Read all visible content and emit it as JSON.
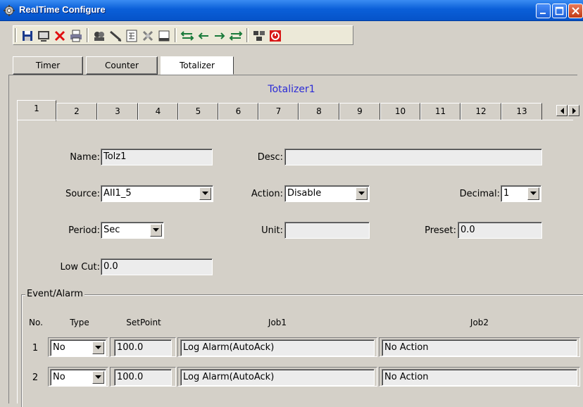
{
  "window": {
    "title": "RealTime Configure",
    "icon": "gear-app-icon",
    "controls": [
      "minimize-icon",
      "maximize-icon",
      "close-icon"
    ]
  },
  "toolbar": {
    "buttons": [
      {
        "name": "save",
        "icon": "floppy-icon"
      },
      {
        "name": "device",
        "icon": "monitor-icon"
      },
      {
        "name": "delete",
        "icon": "red-x-icon"
      },
      {
        "name": "print",
        "icon": "printer-icon"
      },
      {
        "name": "tags",
        "icon": "tag-group-icon"
      },
      {
        "name": "draw",
        "icon": "pencil-icon"
      },
      {
        "name": "calc",
        "icon": "calculator-icon"
      },
      {
        "name": "tools",
        "icon": "tools-icon"
      },
      {
        "name": "window",
        "icon": "window-icon"
      },
      {
        "name": "move-up-down",
        "icon": "arrows-updown-icon"
      },
      {
        "name": "move-left",
        "icon": "arrow-left-icon"
      },
      {
        "name": "move-right",
        "icon": "arrow-right-icon"
      },
      {
        "name": "move-both",
        "icon": "arrows-leftright-icon"
      },
      {
        "name": "network",
        "icon": "network-icon"
      },
      {
        "name": "stop",
        "icon": "stop-icon"
      }
    ]
  },
  "top_tabs": {
    "items": [
      "Timer",
      "Counter",
      "Totalizer"
    ],
    "active": "Totalizer"
  },
  "heading": "Totalizer1",
  "number_tabs": {
    "items": [
      "1",
      "2",
      "3",
      "4",
      "5",
      "6",
      "7",
      "8",
      "9",
      "10",
      "11",
      "12",
      "13"
    ],
    "active": "1"
  },
  "form": {
    "name_label": "Name:",
    "name_value": "Tolz1",
    "desc_label": "Desc:",
    "desc_value": "",
    "source_label": "Source:",
    "source_value": "AII1_5",
    "action_label": "Action:",
    "action_value": "Disable",
    "decimal_label": "Decimal:",
    "decimal_value": "1",
    "period_label": "Period:",
    "period_value": "Sec",
    "unit_label": "Unit:",
    "unit_value": "",
    "preset_label": "Preset:",
    "preset_value": "0.0",
    "lowcut_label": "Low Cut:",
    "lowcut_value": "0.0"
  },
  "event_alarm": {
    "title": "Event/Alarm",
    "columns": [
      "No.",
      "Type",
      "SetPoint",
      "Job1",
      "Job2"
    ],
    "rows": [
      {
        "no": "1",
        "type": "No",
        "setpoint": "100.0",
        "job1": "Log Alarm(AutoAck)",
        "job2": "No Action"
      },
      {
        "no": "2",
        "type": "No",
        "setpoint": "100.0",
        "job1": "Log Alarm(AutoAck)",
        "job2": "No Action"
      }
    ]
  },
  "colors": {
    "titlebar": "#0a5fd8",
    "face": "#d4d0c8",
    "heading": "#2b2bd6"
  }
}
